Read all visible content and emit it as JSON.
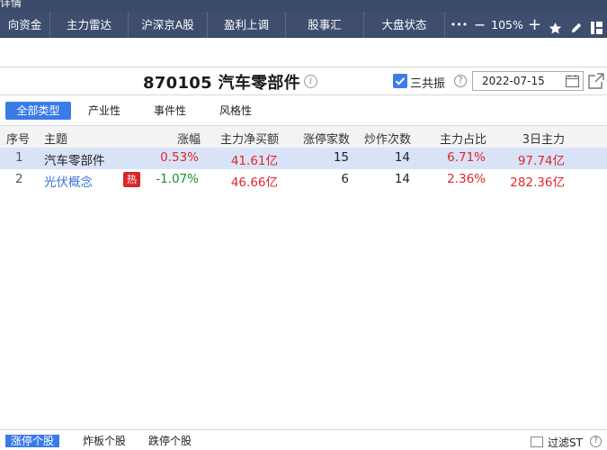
{
  "window": {
    "title_fragment": "详情"
  },
  "nav": {
    "items": [
      "向资金",
      "主力雷达",
      "沪深京A股",
      "盈利上调",
      "股事汇",
      "大盘状态"
    ],
    "more_label": "•••",
    "zoom_out_label": "—",
    "zoom_level": "105%",
    "zoom_in_label": "+"
  },
  "header": {
    "stock_code": "870105",
    "stock_name": "汽车零部件",
    "checkbox_label": "三共振",
    "checkbox_checked": true,
    "date_value": "2022-07-15"
  },
  "type_tabs": {
    "items": [
      "全部类型",
      "产业性",
      "事件性",
      "风格性"
    ],
    "active_index": 0
  },
  "table": {
    "columns": [
      "序号",
      "主题",
      "涨幅",
      "主力净买额",
      "涨停家数",
      "炒作次数",
      "主力占比",
      "3日主力"
    ],
    "rows": [
      {
        "index": "1",
        "theme": "汽车零部件",
        "hot": false,
        "change": "0.53%",
        "net_buy": "41.61亿",
        "limit_up": "15",
        "hype_count": "14",
        "ratio": "6.71%",
        "three_day": "97.74亿"
      },
      {
        "index": "2",
        "theme": "光伏概念",
        "hot": true,
        "hot_label": "热",
        "change": "-1.07%",
        "net_buy": "46.66亿",
        "limit_up": "6",
        "hype_count": "14",
        "ratio": "2.36%",
        "three_day": "282.36亿"
      }
    ]
  },
  "bottom": {
    "tabs": [
      "涨停个股",
      "炸板个股",
      "跌停个股"
    ],
    "active_index": 0,
    "filter_label": "过滤ST"
  },
  "colors": {
    "nav_bg": "#3f4e6e",
    "accent": "#3a7be8",
    "selected_row": "#d9e3f7",
    "up": "#e0262a",
    "down": "#13942c",
    "hot_badge": "#d8262a"
  }
}
